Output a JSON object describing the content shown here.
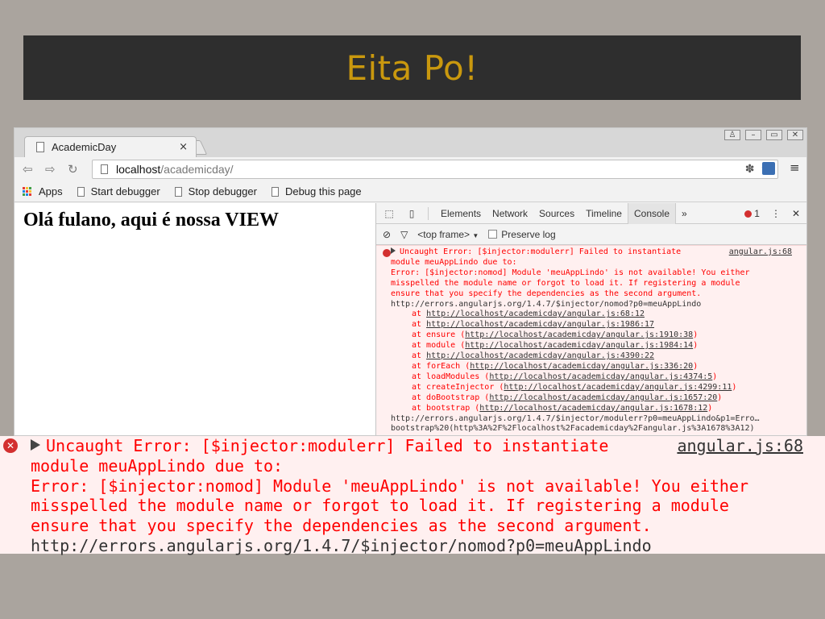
{
  "slide": {
    "title": "Eita Po!"
  },
  "browser": {
    "tab_title": "AcademicDay",
    "tab_close": "×",
    "window_controls": [
      "♙",
      "–",
      "▭",
      "✕"
    ],
    "nav": {
      "back": "⇦",
      "forward": "⇨",
      "reload": "↻"
    },
    "address": {
      "host": "localhost",
      "path": "/academicday/"
    },
    "omni_icons": [
      "✽",
      "☆"
    ],
    "menu": "≡",
    "bookmarks": [
      {
        "label": "Apps"
      },
      {
        "label": "Start debugger"
      },
      {
        "label": "Stop debugger"
      },
      {
        "label": "Debug this page"
      }
    ],
    "apps_colors": [
      "#e53935",
      "#fbc02d",
      "#43a047",
      "#1e88e5",
      "#e53935",
      "#fbc02d",
      "#43a047",
      "#1e88e5",
      "#e53935"
    ]
  },
  "page": {
    "heading": "Olá fulano, aqui é nossa VIEW"
  },
  "devtools": {
    "tabs": [
      "Elements",
      "Network",
      "Sources",
      "Timeline",
      "Console"
    ],
    "active_tab": "Console",
    "more": "»",
    "error_count": "1",
    "kebab": "⋮",
    "close": "✕",
    "frame_select": "<top frame>",
    "frame_arrow": "▼",
    "preserve_log": "Preserve log",
    "console": {
      "source": "angular.js:68",
      "msg_lines": [
        "Uncaught Error: [$injector:modulerr] Failed to instantiate",
        "module meuAppLindo due to:",
        "Error: [$injector:nomod] Module 'meuAppLindo' is not available! You either",
        "misspelled the module name or forgot to load it. If registering a module",
        "ensure that you specify the dependencies as the second argument."
      ],
      "url_line": "http://errors.angularjs.org/1.4.7/$injector/nomod?p0=meuAppLindo",
      "stack": [
        {
          "pre": "at ",
          "link": "http://localhost/academicday/angular.js:68:12",
          "post": ""
        },
        {
          "pre": "at ",
          "link": "http://localhost/academicday/angular.js:1986:17",
          "post": ""
        },
        {
          "pre": "at ensure (",
          "link": "http://localhost/academicday/angular.js:1910:38",
          "post": ")"
        },
        {
          "pre": "at module (",
          "link": "http://localhost/academicday/angular.js:1984:14",
          "post": ")"
        },
        {
          "pre": "at ",
          "link": "http://localhost/academicday/angular.js:4390:22",
          "post": ""
        },
        {
          "pre": "at forEach (",
          "link": "http://localhost/academicday/angular.js:336:20",
          "post": ")"
        },
        {
          "pre": "at loadModules (",
          "link": "http://localhost/academicday/angular.js:4374:5",
          "post": ")"
        },
        {
          "pre": "at createInjector (",
          "link": "http://localhost/academicday/angular.js:4299:11",
          "post": ")"
        },
        {
          "pre": "at doBootstrap (",
          "link": "http://localhost/academicday/angular.js:1657:20",
          "post": ")"
        },
        {
          "pre": "at bootstrap (",
          "link": "http://localhost/academicday/angular.js:1678:12",
          "post": ")"
        }
      ],
      "tail_lines": [
        "http://errors.angularjs.org/1.4.7/$injector/modulerr?p0=meuAppLindo&p1=Erro…",
        "bootstrap%20(http%3A%2F%2Flocalhost%2Facademicday%2Fangular.js%3A1678%3A12)"
      ]
    }
  },
  "zoom": {
    "icon": "✕",
    "source": "angular.js:68",
    "lines": [
      "Uncaught Error: [$injector:modulerr] Failed to instantiate",
      "module meuAppLindo due to:",
      "Error: [$injector:nomod] Module 'meuAppLindo' is not available! You either",
      "misspelled the module name or forgot to load it. If registering a module",
      "ensure that you specify the dependencies as the second argument."
    ],
    "url_line": "http://errors.angularjs.org/1.4.7/$injector/nomod?p0=meuAppLindo"
  }
}
